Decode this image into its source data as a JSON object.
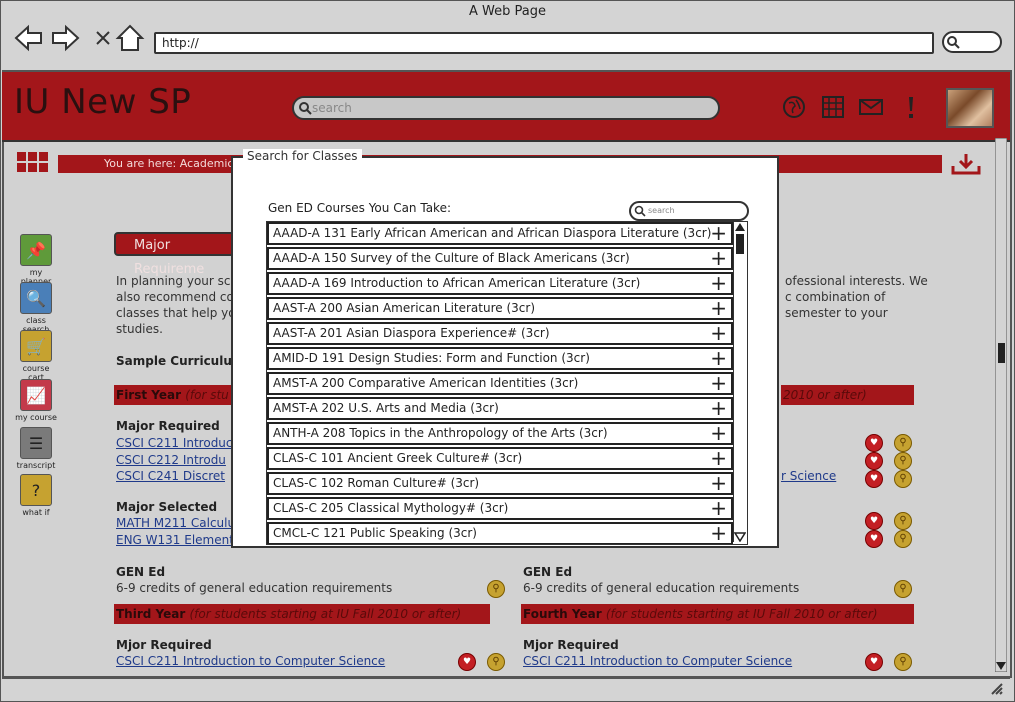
{
  "browser": {
    "title": "A Web Page",
    "url": "http://"
  },
  "header": {
    "logo": "IU New SP",
    "search_placeholder": "search"
  },
  "breadcrumb": {
    "text": "You are here: Academic"
  },
  "sidebar": [
    {
      "label": "my planner",
      "icon": "pushpin-icon",
      "color": "#5f9a3a",
      "glyph": "📌"
    },
    {
      "label": "class search",
      "icon": "magnifier-icon",
      "color": "#4a7fb8",
      "glyph": "🔍"
    },
    {
      "label": "course cart",
      "icon": "cart-icon",
      "color": "#c6a230",
      "glyph": "🛒"
    },
    {
      "label": "my course",
      "icon": "chart-icon",
      "color": "#c33a4a",
      "glyph": "📈"
    },
    {
      "label": "transcript",
      "icon": "list-icon",
      "color": "#7a7a7a",
      "glyph": "☰"
    },
    {
      "label": "what if",
      "icon": "question-icon",
      "color": "#c6a230",
      "glyph": "?"
    }
  ],
  "background": {
    "major_button": "Major Requireme",
    "intro_left": "In planning your sche",
    "intro_left2": "also recommend cor",
    "intro_left3": "classes that help you",
    "intro_left4": "studies.",
    "intro_right": "ofessional interests. We",
    "intro_right2": "c combination of",
    "intro_right3": "semester to your",
    "sample_curriculum": "Sample Curriculum",
    "first_year": "First Year",
    "first_year_note": "(for stu",
    "first_year_right": "2010 or after)",
    "major_required": "Major Required",
    "links_left": [
      "CSCI C211 Introduc",
      "CSCI C212 Introdu",
      "CSCI C241 Discret"
    ],
    "science_link": "r Science",
    "major_selected": "Major Selected",
    "selected_links": [
      "MATH M211 Calculus",
      "ENG W131 Element"
    ],
    "gen_ed_left": "GEN Ed",
    "gen_ed_left_text": "6-9 credits of general education requirements",
    "gen_ed_right": "GEN Ed",
    "gen_ed_right_text": "6-9 credits of general education requirements",
    "third_year": "Third Year",
    "third_year_note": "(for students starting at IU Fall 2010 or after)",
    "fourth_year": "Fourth Year",
    "fourth_year_note": "(for students starting at IU Fall 2010 or after)",
    "mjor_required_left": "Mjor Required",
    "mjor_required_right": "Mjor Required",
    "bottom_link_left": "CSCI C211 Introduction to Computer Science",
    "bottom_link_right": "CSCI C211 Introduction to Computer Science"
  },
  "modal": {
    "title": "Search for Classes",
    "list_label": "Gen ED Courses You Can Take:",
    "search_placeholder": "search",
    "courses": [
      "AAAD-A 131 Early African American and African Diaspora Literature (3cr)",
      "AAAD-A 150 Survey of the Culture of Black Americans (3cr)",
      "AAAD-A 169 Introduction to African American Literature (3cr)",
      "AAST-A 200 Asian American Literature (3cr)",
      "AAST-A 201 Asian Diaspora Experience# (3cr)",
      "AMID-D 191 Design Studies: Form and Function (3cr)",
      "AMST-A 200 Comparative American Identities (3cr)",
      "AMST-A 202 U.S. Arts and Media (3cr)",
      "ANTH-A 208 Topics in the Anthropology of the Arts (3cr)",
      "CLAS-C 101 Ancient Greek Culture# (3cr)",
      "CLAS-C 102 Roman Culture# (3cr)",
      "CLAS-C 205 Classical Mythology# (3cr)",
      "CMCL-C 121 Public Speaking (3cr)"
    ],
    "add_icon": "+"
  },
  "colors": {
    "brand_red": "#a3161a",
    "link_blue": "#1f3a8a"
  }
}
